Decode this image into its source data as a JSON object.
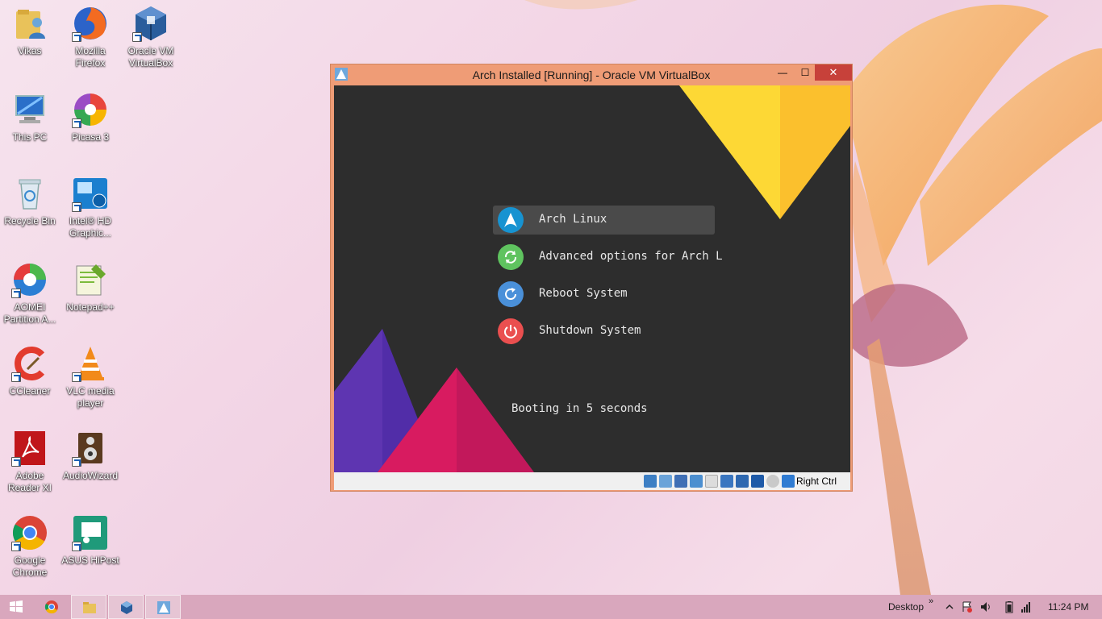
{
  "desktop": {
    "icons": [
      {
        "label": "Vikas"
      },
      {
        "label": "Mozilla Firefox"
      },
      {
        "label": "Oracle VM VirtualBox"
      },
      {
        "label": "This PC"
      },
      {
        "label": "Picasa 3"
      },
      {
        "label": "Recycle Bin"
      },
      {
        "label": "Intel® HD Graphic..."
      },
      {
        "label": "AOMEI Partition A..."
      },
      {
        "label": "Notepad++"
      },
      {
        "label": "CCleaner"
      },
      {
        "label": "VLC media player"
      },
      {
        "label": "Adobe Reader XI"
      },
      {
        "label": "AudioWizard"
      },
      {
        "label": "Google Chrome"
      },
      {
        "label": "ASUS HiPost"
      }
    ]
  },
  "vbox_window": {
    "title": "Arch Installed [Running] - Oracle VM VirtualBox",
    "minimize": "—",
    "maximize": "☐",
    "close": "✕",
    "boot_menu": {
      "items": [
        {
          "label": "Arch Linux",
          "icon": "arch-icon",
          "color": "#1793d1",
          "selected": true
        },
        {
          "label": "Advanced options for Arch L",
          "icon": "refresh-icon",
          "color": "#5fc35f"
        },
        {
          "label": "Reboot System",
          "icon": "reboot-icon",
          "color": "#4a90d9"
        },
        {
          "label": "Shutdown System",
          "icon": "power-icon",
          "color": "#ea4f4f"
        }
      ],
      "boot_message": "Booting in 5 seconds"
    },
    "statusbar": {
      "host_key": "Right Ctrl"
    }
  },
  "taskbar": {
    "desktop_label": "Desktop",
    "chevron": "»",
    "clock": "11:24 PM"
  },
  "colors": {
    "titlebar": "#ef9c76",
    "vm_background": "#2d2d2d",
    "taskbar": "#d9a7bd"
  }
}
